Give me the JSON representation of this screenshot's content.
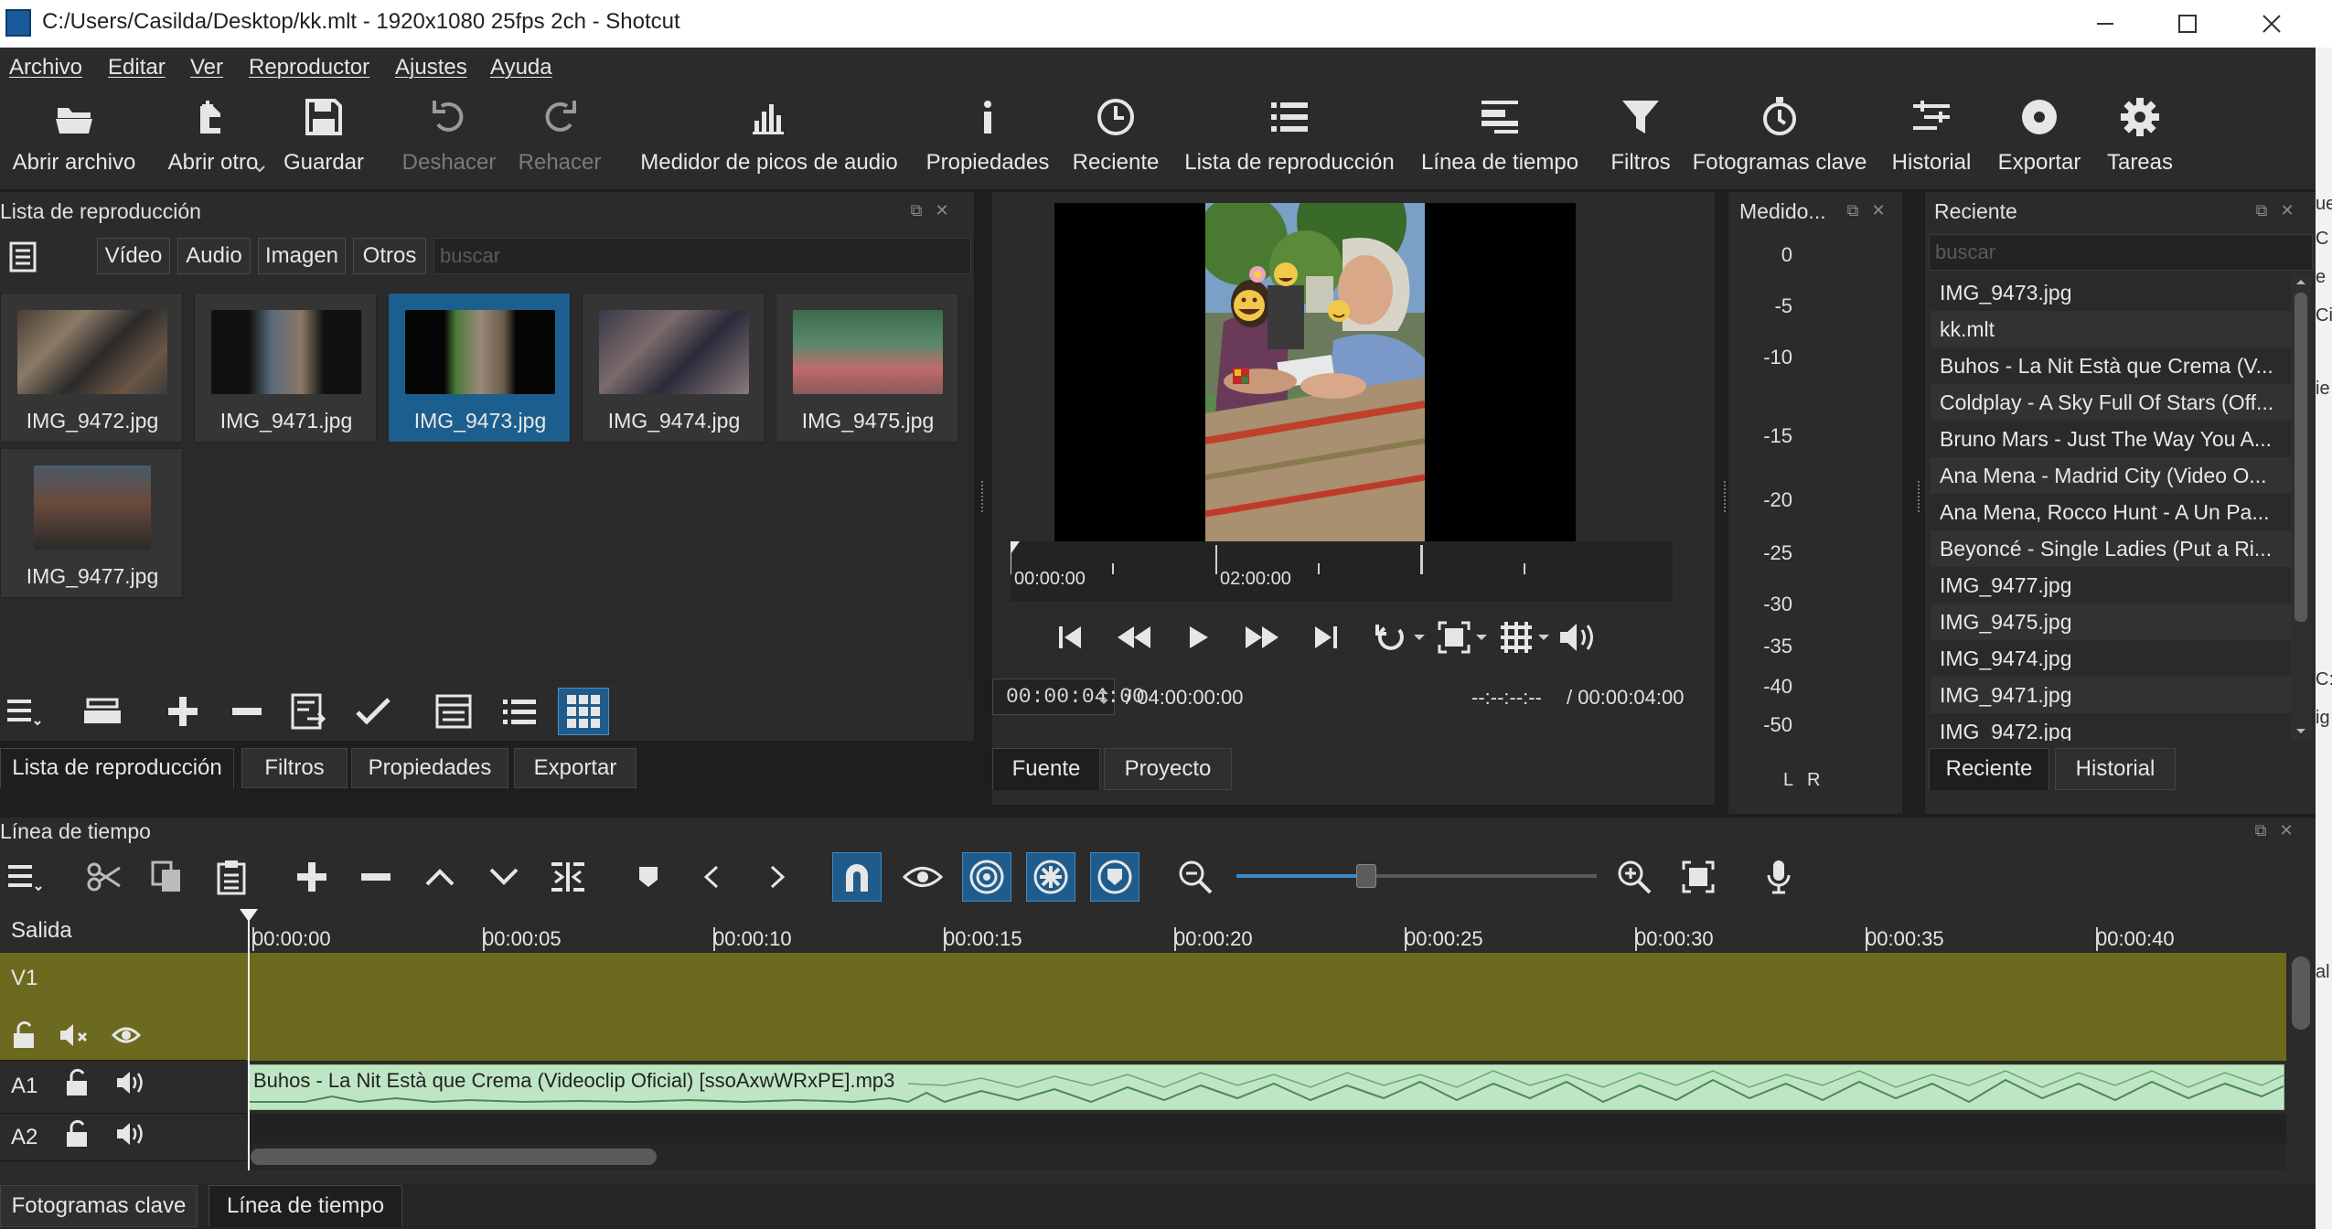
{
  "window": {
    "title": "C:/Users/Casilda/Desktop/kk.mlt - 1920x1080 25fps 2ch - Shotcut"
  },
  "menu": [
    "Archivo",
    "Editar",
    "Ver",
    "Reproductor",
    "Ajustes",
    "Ayuda"
  ],
  "toolbar": {
    "open_file": "Abrir archivo",
    "open_other": "Abrir otro",
    "save": "Guardar",
    "undo": "Deshacer",
    "redo": "Rehacer",
    "peak_meter": "Medidor de picos de audio",
    "properties": "Propiedades",
    "recent": "Reciente",
    "playlist": "Lista de reproducción",
    "timeline": "Línea de tiempo",
    "filters": "Filtros",
    "keyframes": "Fotogramas clave",
    "history": "Historial",
    "export": "Exportar",
    "jobs": "Tareas"
  },
  "playlist": {
    "title": "Lista de reproducción",
    "filters": [
      "Vídeo",
      "Audio",
      "Imagen",
      "Otros"
    ],
    "search_placeholder": "buscar",
    "items": [
      "IMG_9472.jpg",
      "IMG_9471.jpg",
      "IMG_9473.jpg",
      "IMG_9474.jpg",
      "IMG_9475.jpg",
      "IMG_9477.jpg"
    ],
    "selected": "IMG_9473.jpg",
    "tabs": [
      "Lista de reproducción",
      "Filtros",
      "Propiedades",
      "Exportar"
    ]
  },
  "player": {
    "ruler_labels": [
      "00:00:00",
      "02:00:00"
    ],
    "position": "00:00:04:00",
    "duration": "/  04:00:00:00",
    "in_out": "--:--:--:--",
    "in_out_duration": "/  00:00:04:00",
    "tabs": [
      "Fuente",
      "Proyecto"
    ]
  },
  "meter": {
    "title": "Medido...",
    "scale": [
      "0",
      "-5",
      "-10",
      "-15",
      "-20",
      "-25",
      "-30",
      "-35",
      "-40",
      "-50"
    ],
    "left": "L",
    "right": "R"
  },
  "recent": {
    "title": "Reciente",
    "search_placeholder": "buscar",
    "items": [
      "IMG_9473.jpg",
      "kk.mlt",
      "Buhos - La Nit Està que Crema (V...",
      "Coldplay - A Sky Full Of Stars (Off...",
      "Bruno Mars - Just The Way You A...",
      "Ana Mena - Madrid City (Video O...",
      "Ana Mena, Rocco Hunt - A Un Pa...",
      "Beyoncé - Single Ladies (Put a Ri...",
      "IMG_9477.jpg",
      "IMG_9475.jpg",
      "IMG_9474.jpg",
      "IMG_9471.jpg",
      "IMG_9472.jpg"
    ],
    "tabs": [
      "Reciente",
      "Historial"
    ]
  },
  "timeline": {
    "title": "Línea de tiempo",
    "output_label": "Salida",
    "ticks": [
      "00:00:00",
      "00:00:05",
      "00:00:10",
      "00:00:15",
      "00:00:20",
      "00:00:25",
      "00:00:30",
      "00:00:35",
      "00:00:40"
    ],
    "tracks": [
      "V1",
      "A1",
      "A2"
    ],
    "clip_name": "Buhos - La Nit Està que Crema (Videoclip Oficial) [ssoAxwWRxPE].mp3",
    "zoom": 0.36
  },
  "bottom_tabs": [
    "Fotogramas clave",
    "Línea de tiempo"
  ],
  "right_strip": [
    "ue",
    "C",
    "e",
    "Cit",
    "ie",
    "C:",
    "ig",
    "al"
  ],
  "colors": {
    "accent": "#1f5c8c",
    "video_track": "#6b6a1e",
    "audio_clip": "#bfe6c4",
    "waveform": "#4a8a54",
    "panel": "#2b2b2b",
    "background": "#1e1e1e"
  }
}
